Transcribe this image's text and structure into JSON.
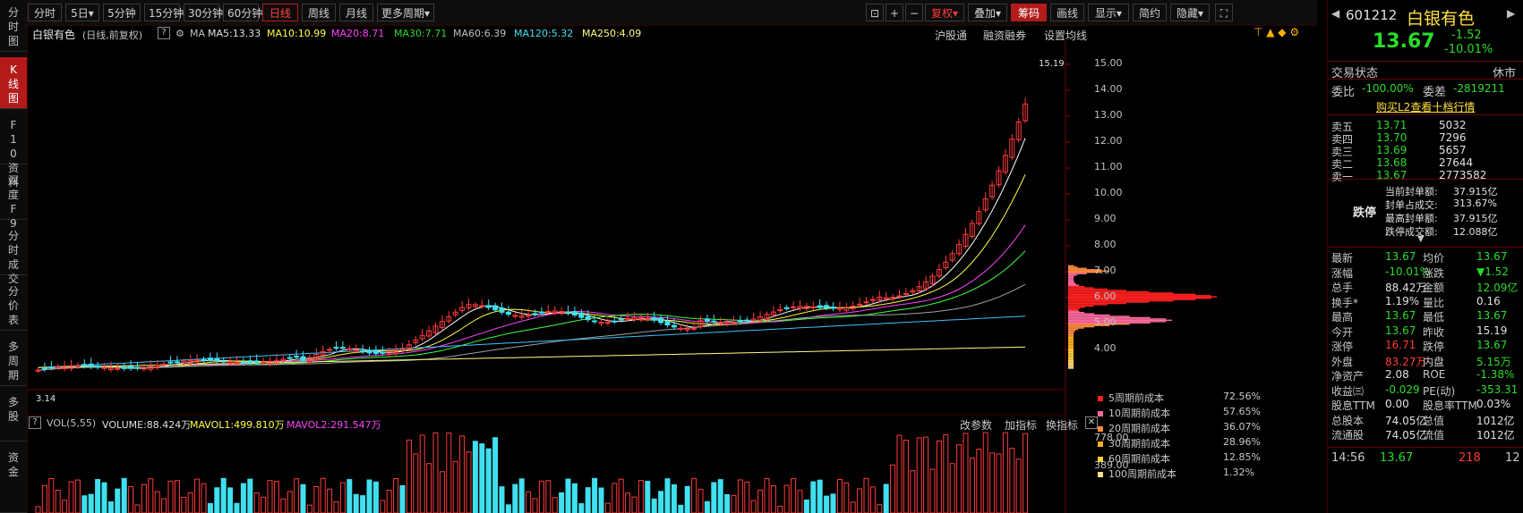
{
  "left_tabs": [
    "分时图",
    "K线图",
    "F10资料",
    "深度F9",
    "分时成交",
    "分价表",
    "多周期",
    "多股",
    "资金"
  ],
  "toolbar": {
    "periods": [
      "分时",
      "5日▾",
      "5分钟",
      "15分钟",
      "30分钟",
      "60分钟",
      "日线",
      "周线",
      "月线",
      "更多周期▾"
    ],
    "right": [
      "复权▾",
      "叠加▾",
      "筹码",
      "画线",
      "显示▾",
      "简约",
      "隐藏▾"
    ]
  },
  "info": {
    "name": "白银有色",
    "mode": "(日线,前复权)",
    "q": "?",
    "ma_label": "MA",
    "ma5": "MA5:13.33",
    "ma10": "MA10:10.99",
    "ma20": "MA20:8.71",
    "ma30": "MA30:7.71",
    "ma60": "MA60:6.39",
    "ma120": "MA120:5.32",
    "ma250": "MA250:4.09",
    "hgt": "沪股通",
    "rzrq": "融资融券",
    "set_ma": "设置均线"
  },
  "price_axis": [
    "15.00",
    "14.00",
    "13.00",
    "12.00",
    "11.00",
    "10.00",
    "9.00",
    "8.00",
    "7.00",
    "6.00",
    "5.00",
    "4.00"
  ],
  "annotations": {
    "high": "15.19",
    "low": "3.14"
  },
  "volume": {
    "label": "VOL(5,55)",
    "volume": "VOLUME:88.424万",
    "mavol1": "MAVOL1:499.810万",
    "mavol2": "MAVOL2:291.547万",
    "axis": [
      "778.00",
      "389.00"
    ],
    "buttons": [
      "改参数",
      "加指标",
      "换指标"
    ]
  },
  "chip_legend": [
    {
      "label": "5周期前成本",
      "value": "72.56%",
      "color": "#ff2020"
    },
    {
      "label": "10周期前成本",
      "value": "57.65%",
      "color": "#ff6aa0"
    },
    {
      "label": "20周期前成本",
      "value": "36.07%",
      "color": "#ff8c40"
    },
    {
      "label": "30周期前成本",
      "value": "28.96%",
      "color": "#ffb020"
    },
    {
      "label": "60周期前成本",
      "value": "12.85%",
      "color": "#ffd040"
    },
    {
      "label": "100周期前成本",
      "value": "1.32%",
      "color": "#ffe080"
    }
  ],
  "quote": {
    "code": "601212",
    "name": "白银有色",
    "price": "13.67",
    "change": "-1.52",
    "pct": "-10.01%",
    "status_label": "交易状态",
    "status": "休市",
    "wb_label": "委比",
    "wb": "-100.00%",
    "wc_label": "委差",
    "wc": "-2819211",
    "l2": "购买L2查看十档行情",
    "asks": [
      {
        "label": "卖五",
        "price": "13.71",
        "vol": "5032"
      },
      {
        "label": "卖四",
        "price": "13.70",
        "vol": "7296"
      },
      {
        "label": "卖三",
        "price": "13.69",
        "vol": "5657"
      },
      {
        "label": "卖二",
        "price": "13.68",
        "vol": "27644"
      },
      {
        "label": "卖一",
        "price": "13.67",
        "vol": "2773582"
      }
    ],
    "limit_down_label": "跌停",
    "seal": [
      {
        "label": "当前封单额:",
        "value": "37.915亿"
      },
      {
        "label": "封单占成交:",
        "value": "313.67%"
      },
      {
        "label": "最高封单额:",
        "value": "37.915亿"
      },
      {
        "label": "跌停成交额:",
        "value": "12.088亿"
      }
    ],
    "stats": [
      [
        "最新",
        "13.67",
        "均价",
        "13.67"
      ],
      [
        "涨幅",
        "-10.01%",
        "涨跌",
        "▼1.52"
      ],
      [
        "总手",
        "88.42万",
        "金额",
        "12.09亿"
      ],
      [
        "换手*",
        "1.19%",
        "量比",
        "0.16"
      ],
      [
        "最高",
        "13.67",
        "最低",
        "13.67"
      ],
      [
        "今开",
        "13.67",
        "昨收",
        "15.19"
      ],
      [
        "涨停",
        "16.71",
        "跌停",
        "13.67"
      ],
      [
        "外盘",
        "83.27万",
        "内盘",
        "5.15万"
      ],
      [
        "净资产",
        "2.08",
        "ROE",
        "-1.38%"
      ],
      [
        "收益㈢",
        "-0.029",
        "PE(动)",
        "-353.31"
      ],
      [
        "股息TTM",
        "0.00",
        "股息率TTM",
        "0.03%"
      ],
      [
        "总股本",
        "74.05亿",
        "总值",
        "1012亿"
      ],
      [
        "流通股",
        "74.05亿",
        "流值",
        "1012亿"
      ]
    ],
    "tick": {
      "time": "14:56",
      "price": "13.67",
      "vol": "218",
      "n": "12"
    }
  },
  "colors": {
    "up": "#ff3a3a",
    "down": "#2adb2a",
    "cyan": "#40e0f0",
    "ma5": "#ffffff",
    "ma10": "#ffff40",
    "ma20": "#ff40ff",
    "ma30": "#40ff40",
    "ma60": "#a0a0a0",
    "ma120": "#40c0ff",
    "ma250": "#ffff80"
  }
}
